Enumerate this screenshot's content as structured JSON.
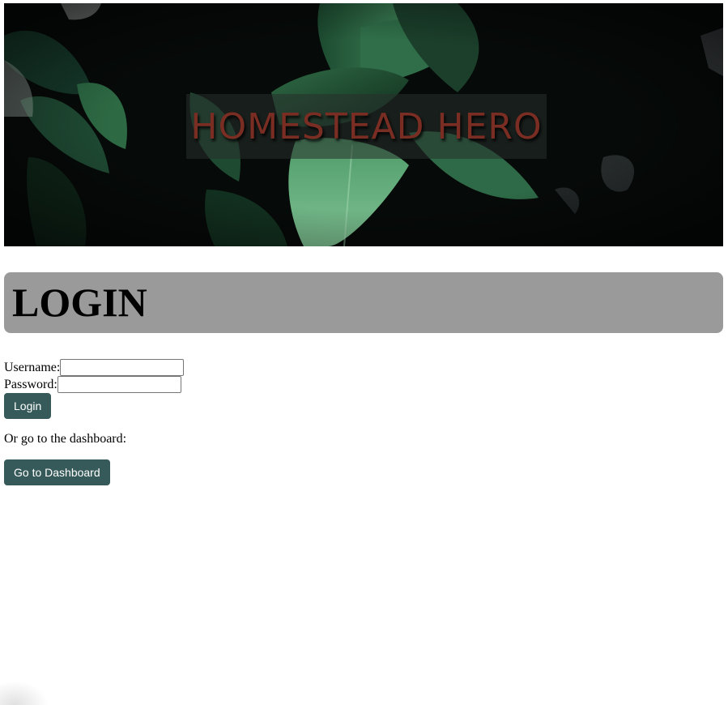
{
  "banner": {
    "title": "HOMESTEAD HERO",
    "title_color": "#7a2d22"
  },
  "login_section": {
    "heading": "LOGIN"
  },
  "form": {
    "username_label": "Username:",
    "username_value": "",
    "password_label": "Password:",
    "password_value": "",
    "login_button": "Login"
  },
  "dashboard": {
    "text": "Or go to the dashboard:",
    "button": "Go to Dashboard"
  },
  "colors": {
    "button_bg": "#365a5a",
    "header_bg": "#9a9a9a"
  }
}
